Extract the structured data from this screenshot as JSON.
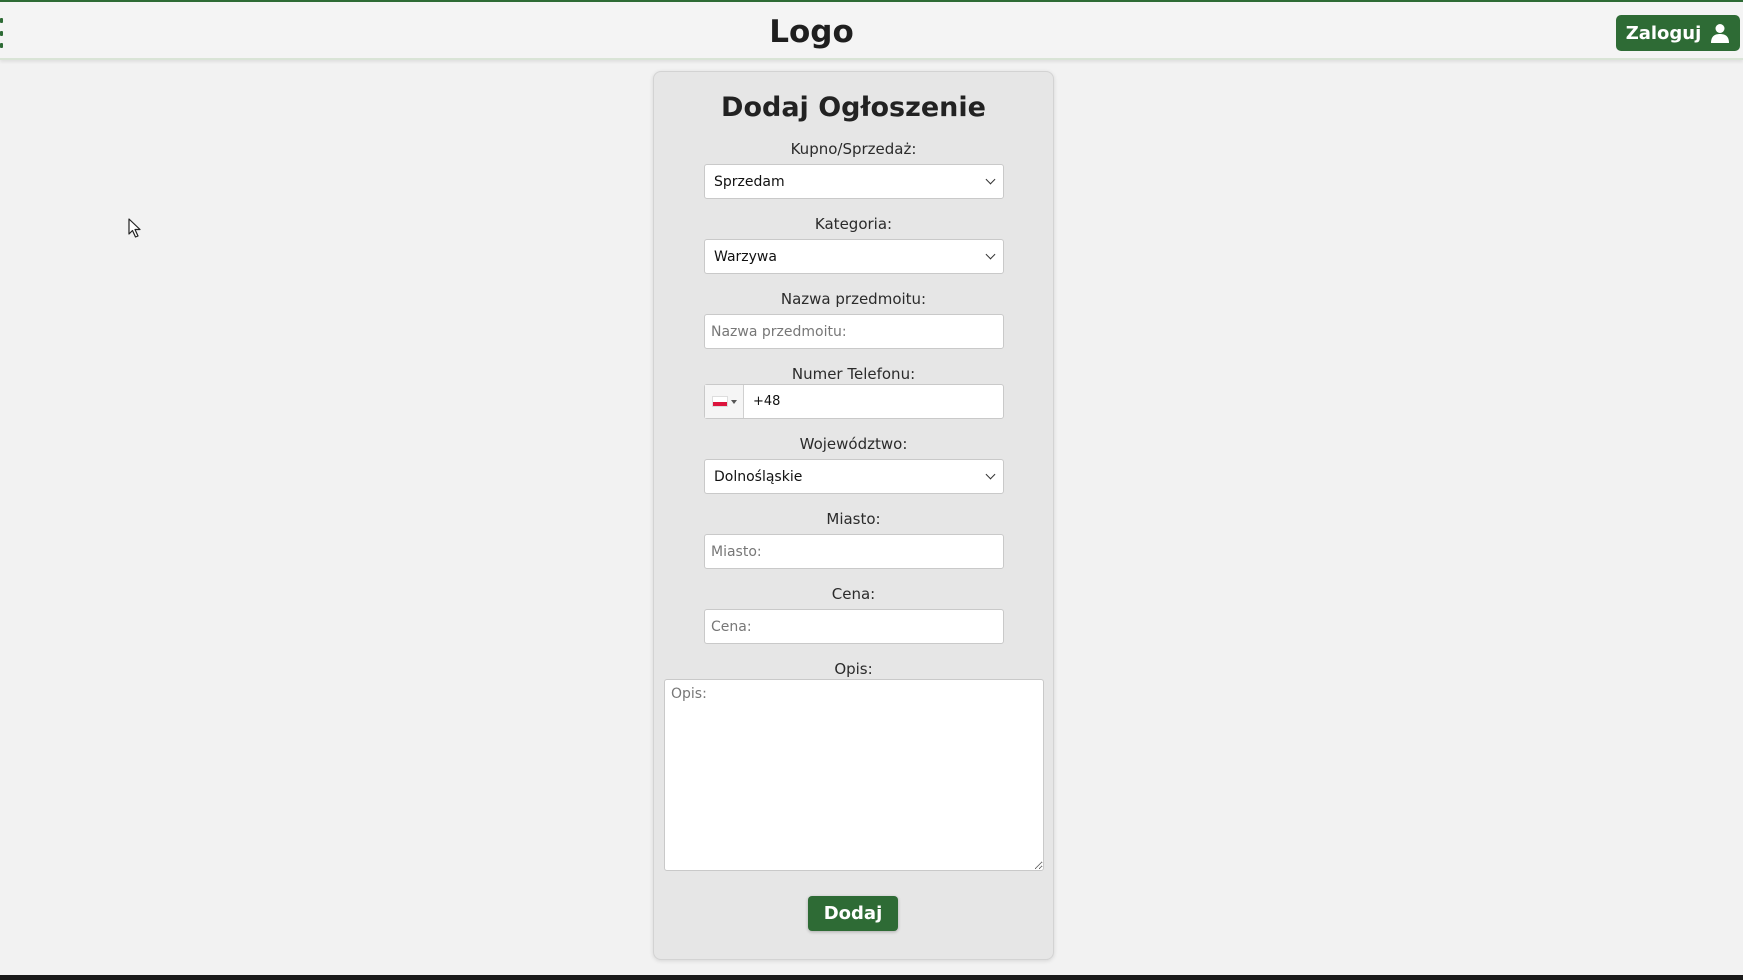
{
  "header": {
    "logo": "Logo",
    "login_label": "Zaloguj"
  },
  "form": {
    "title": "Dodaj Ogłoszenie",
    "fields": {
      "type": {
        "label": "Kupno/Sprzedaż:",
        "value": "Sprzedam"
      },
      "category": {
        "label": "Kategoria:",
        "value": "Warzywa"
      },
      "name": {
        "label": "Nazwa przedmoitu:",
        "placeholder": "Nazwa przedmoitu:"
      },
      "phone": {
        "label": "Numer Telefonu:",
        "value": "+48",
        "country": "pl-flag-icon"
      },
      "region": {
        "label": "Województwo:",
        "value": "Dolnośląskie"
      },
      "city": {
        "label": "Miasto:",
        "placeholder": "Miasto:"
      },
      "price": {
        "label": "Cena:",
        "placeholder": "Cena:"
      },
      "description": {
        "label": "Opis:",
        "placeholder": "Opis:"
      }
    },
    "submit_label": "Dodaj"
  },
  "colors": {
    "accent": "#2e6b35",
    "background": "#f2f2f2",
    "card": "#e6e6e6"
  }
}
